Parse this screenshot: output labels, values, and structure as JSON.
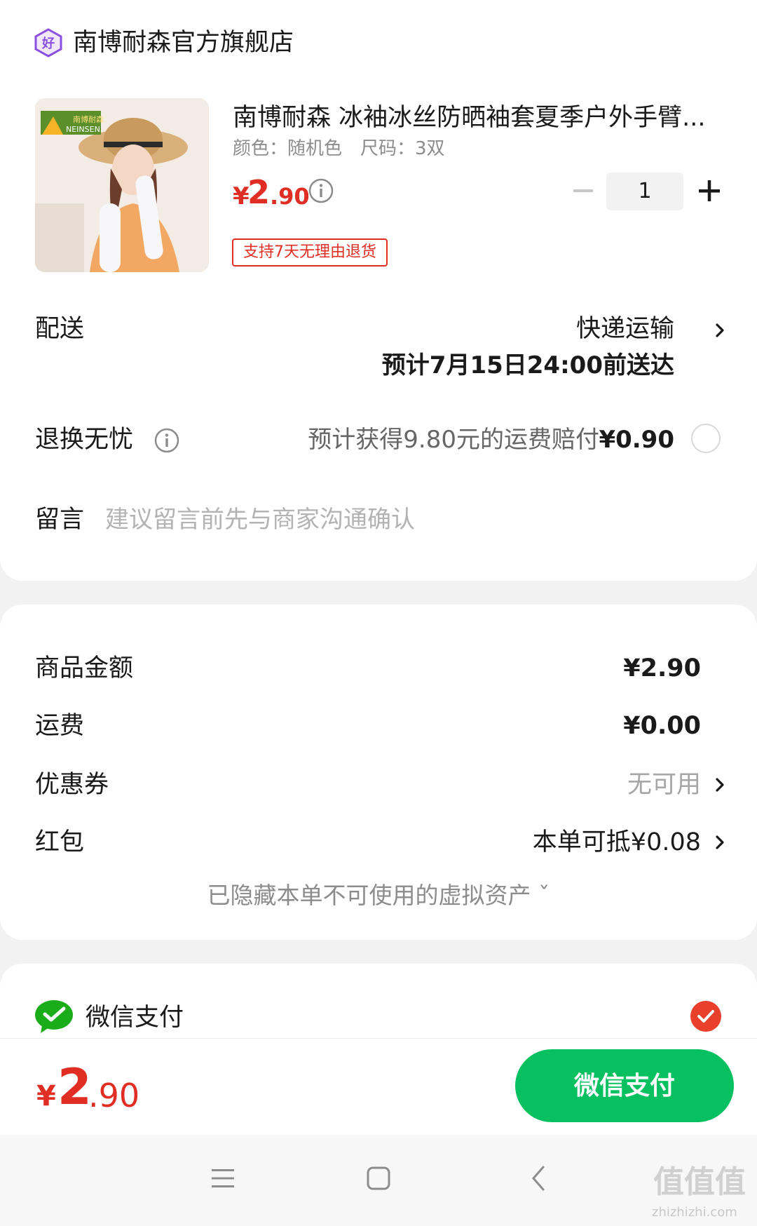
{
  "store": {
    "name": "南博耐森官方旗舰店",
    "icon": "good-store-badge-icon"
  },
  "product": {
    "title": "南博耐森 冰袖冰丝防晒袖套夏季户外手臂...",
    "spec": "颜色：随机色　尺码：3双",
    "price_yen": "¥",
    "price_int": "2",
    "price_dec": ".90",
    "quantity": "1",
    "return_badge": "支持7天无理由退货"
  },
  "delivery": {
    "label": "配送",
    "method": "快递运输",
    "eta": "预计7月15日24:00前送达"
  },
  "return_insurance": {
    "label": "退换无忧",
    "desc": "预计获得9.80元的运费赔付",
    "price": "¥0.90"
  },
  "message": {
    "label": "留言",
    "placeholder": "建议留言前先与商家沟通确认"
  },
  "summary": {
    "goods_label": "商品金额",
    "goods_value": "¥2.90",
    "shipping_label": "运费",
    "shipping_value": "¥0.00",
    "coupon_label": "优惠券",
    "coupon_value": "无可用",
    "redpacket_label": "红包",
    "redpacket_value": "本单可抵¥0.08",
    "hidden_assets": "已隐藏本单不可使用的虚拟资产 ˇ"
  },
  "payment": {
    "method_label": "微信支付",
    "selected": true
  },
  "footer": {
    "total_yen": "¥",
    "total_int": "2",
    "total_dec": ".90",
    "pay_button": "微信支付"
  },
  "watermark": {
    "text": "值值值",
    "url": "zhizhizhi.com"
  },
  "colors": {
    "price_red": "#e02e24",
    "wechat_green": "#07c160",
    "muted": "#a6a6a6"
  }
}
